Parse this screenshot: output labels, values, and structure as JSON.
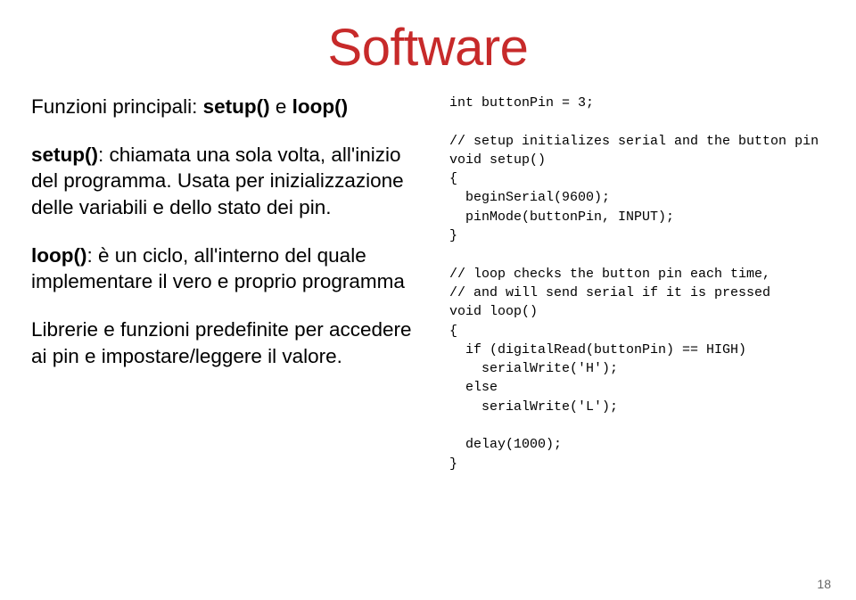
{
  "title": "Software",
  "left": {
    "p1_pre": "Funzioni principali: ",
    "p1_b1": "setup()",
    "p1_mid": " e ",
    "p1_b2": "loop()",
    "p2_b": "setup()",
    "p2_rest": ": chiamata una sola volta, all'inizio del programma. Usata per inizializzazione delle variabili e dello stato dei pin.",
    "p3_b": "loop()",
    "p3_rest": ": è un ciclo, all'interno del quale implementare il vero e proprio programma",
    "p4": "Librerie e funzioni predefinite per accedere ai pin e impostare/leggere il valore."
  },
  "code": "int buttonPin = 3;\n\n// setup initializes serial and the button pin\nvoid setup()\n{\n  beginSerial(9600);\n  pinMode(buttonPin, INPUT);\n}\n\n// loop checks the button pin each time,\n// and will send serial if it is pressed\nvoid loop()\n{\n  if (digitalRead(buttonPin) == HIGH)\n    serialWrite('H');\n  else\n    serialWrite('L');\n\n  delay(1000);\n}",
  "pagenum": "18"
}
